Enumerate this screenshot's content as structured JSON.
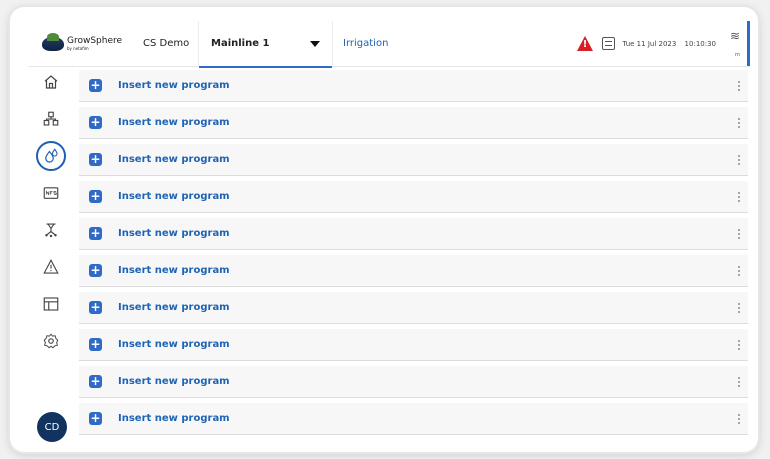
{
  "header": {
    "brand_name": "GrowSphere",
    "brand_tagline": "by netafim",
    "site_name": "CS Demo",
    "mainline_selector": "Mainline 1",
    "section_title": "Irrigation",
    "date": "Tue 11 Jul 2023",
    "time": "10:10:30",
    "wifi_caption": "m",
    "alert_symbol": "!",
    "alert_color": "#d91f26",
    "accent_color": "#2f6cc9"
  },
  "sidebar": {
    "items": [
      {
        "name": "home",
        "icon": "home-icon"
      },
      {
        "name": "groups",
        "icon": "groups-icon"
      },
      {
        "name": "irrigation",
        "icon": "water-drop-icon",
        "active": true
      },
      {
        "name": "nfs",
        "icon": "nfs-icon"
      },
      {
        "name": "network",
        "icon": "network-icon"
      },
      {
        "name": "alarms",
        "icon": "warning-icon"
      },
      {
        "name": "reports",
        "icon": "table-icon"
      },
      {
        "name": "settings",
        "icon": "gear-icon"
      }
    ],
    "avatar_initials": "CD"
  },
  "programs": {
    "rows": [
      {
        "label": "Insert new program",
        "icon": "plus-icon"
      },
      {
        "label": "Insert new program",
        "icon": "plus-icon"
      },
      {
        "label": "Insert new program",
        "icon": "plus-icon"
      },
      {
        "label": "Insert new program",
        "icon": "plus-icon"
      },
      {
        "label": "Insert new program",
        "icon": "plus-icon"
      },
      {
        "label": "Insert new program",
        "icon": "plus-icon"
      },
      {
        "label": "Insert new program",
        "icon": "plus-icon"
      },
      {
        "label": "Insert new program",
        "icon": "plus-icon"
      },
      {
        "label": "Insert new program",
        "icon": "plus-icon"
      },
      {
        "label": "Insert new program",
        "icon": "plus-icon"
      }
    ]
  }
}
